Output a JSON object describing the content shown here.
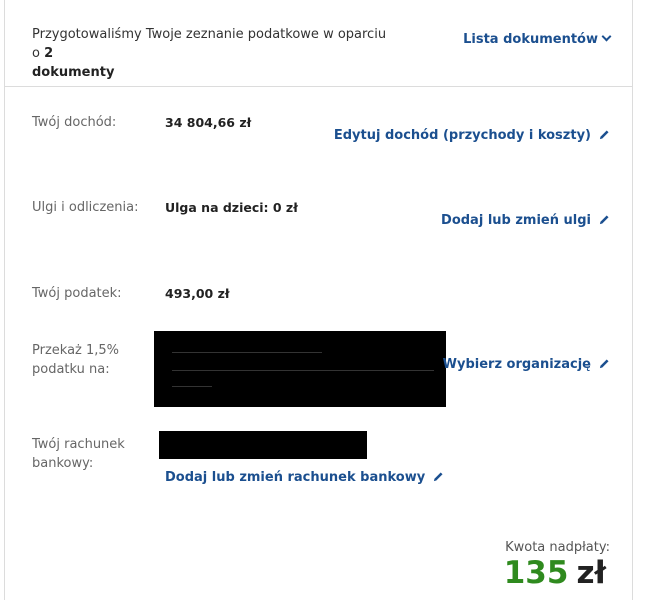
{
  "intro": {
    "text_before": "Przygotowaliśmy Twoje zeznanie podatkowe w oparciu o ",
    "count": "2",
    "text_after": "dokumenty",
    "document_list_link": "Lista dokumentów"
  },
  "income": {
    "label": "Twój dochód:",
    "value": "34 804,66 zł",
    "action": "Edytuj dochód (przychody i koszty)"
  },
  "reliefs": {
    "label": "Ulgi i odliczenia:",
    "value": "Ulga na dzieci: 0 zł",
    "action": "Dodaj lub zmień ulgi"
  },
  "tax": {
    "label": "Twój podatek:",
    "value": "493,00 zł"
  },
  "donation": {
    "label": "Przekaż 1,5% podatku na:",
    "action": "Wybierz organizację"
  },
  "bank": {
    "label": "Twój rachunek bankowy:",
    "action": "Dodaj lub zmień rachunek bankowy"
  },
  "overpayment": {
    "label": "Kwota nadpłaty:",
    "amount": "135",
    "currency": "zł"
  },
  "colors": {
    "link": "#1b4f8f",
    "amount_green": "#2f8a1e",
    "border": "#dcdcdc"
  }
}
